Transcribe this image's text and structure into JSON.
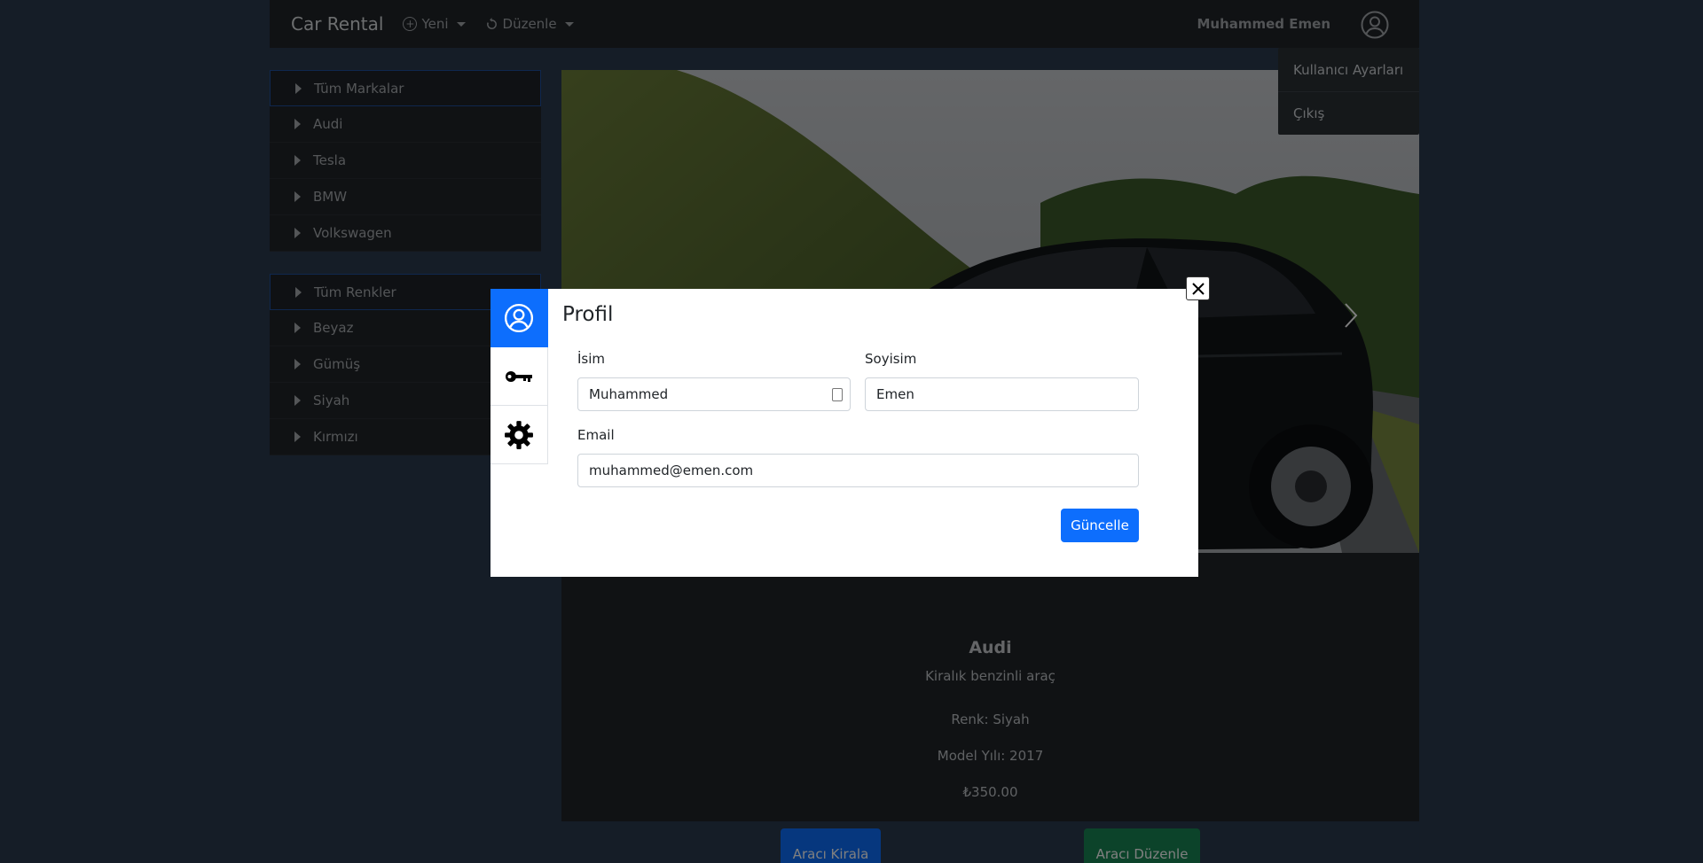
{
  "navbar": {
    "brand": "Car Rental",
    "new_label": "Yeni",
    "edit_label": "Düzenle",
    "user_name": "Muhammed Emen"
  },
  "user_menu": {
    "items": [
      {
        "label": "Kullanıcı Ayarları"
      },
      {
        "label": "Çıkış"
      }
    ]
  },
  "brands": {
    "items": [
      {
        "label": "Tüm Markalar",
        "active": true
      },
      {
        "label": "Audi"
      },
      {
        "label": "Tesla"
      },
      {
        "label": "BMW"
      },
      {
        "label": "Volkswagen"
      }
    ]
  },
  "colors": {
    "items": [
      {
        "label": "Tüm Renkler",
        "active": true
      },
      {
        "label": "Beyaz"
      },
      {
        "label": "Gümüş"
      },
      {
        "label": "Siyah"
      },
      {
        "label": "Kırmızı"
      }
    ]
  },
  "car": {
    "title": "Audi",
    "description": "Kiralık benzinli araç",
    "color": "Renk: Siyah",
    "year": "Model Yılı: 2017",
    "price": "₺350.00",
    "rent_label": "Aracı Kirala",
    "edit_label": "Aracı Düzenle"
  },
  "modal": {
    "title": "Profil",
    "tabs": [
      "user-circle-icon",
      "key-icon",
      "gear-icon"
    ],
    "first_name_label": "İsim",
    "first_name_value": "Muhammed",
    "last_name_label": "Soyisim",
    "last_name_value": "Emen",
    "email_label": "Email",
    "email_value": "muhammed@emen.com",
    "update_label": "Güncelle"
  },
  "colors_theme": {
    "primary": "#0d6efd",
    "success": "#198754",
    "navbar_bg": "#212529",
    "page_bg": "#2b3a4e"
  }
}
